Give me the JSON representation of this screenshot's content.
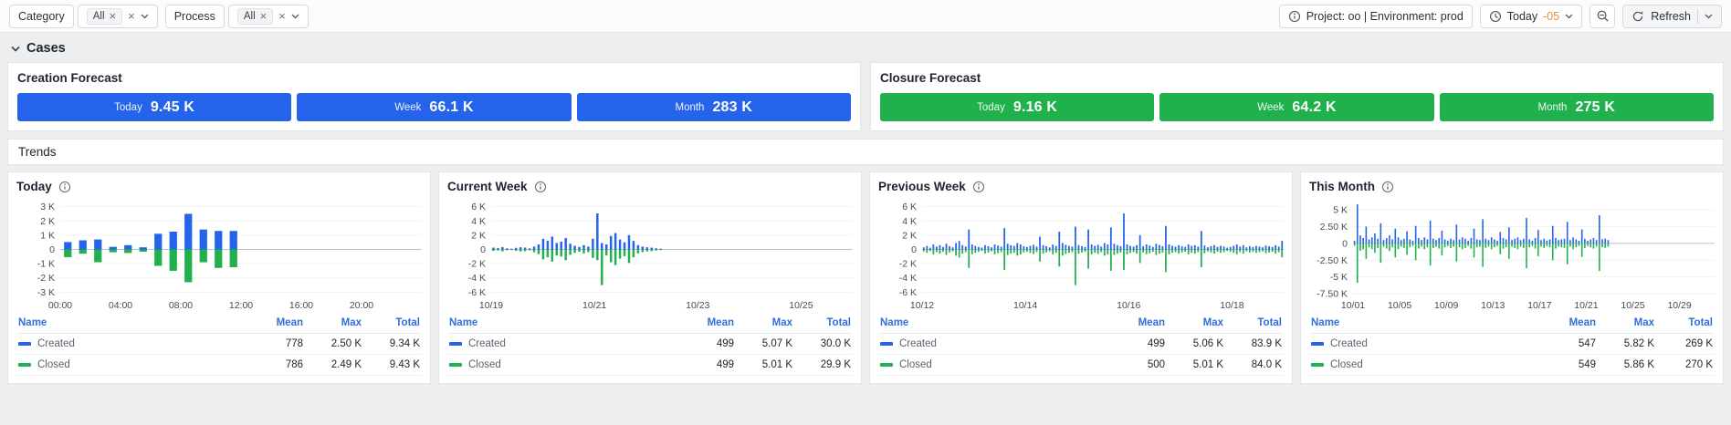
{
  "icons": {
    "close": "×"
  },
  "toolbar": {
    "filters": [
      {
        "label": "Category",
        "tag": "All"
      },
      {
        "label": "Process",
        "tag": "All"
      }
    ],
    "project_info": "Project: oo | Environment: prod",
    "time": {
      "label": "Today",
      "offset": "-05"
    },
    "refresh": "Refresh"
  },
  "section_title": "Cases",
  "forecasts": [
    {
      "title": "Creation Forecast",
      "color": "#2563eb",
      "stats": [
        {
          "label": "Today",
          "value": "9.45 K"
        },
        {
          "label": "Week",
          "value": "66.1 K"
        },
        {
          "label": "Month",
          "value": "283 K"
        }
      ]
    },
    {
      "title": "Closure Forecast",
      "color": "#21b14c",
      "stats": [
        {
          "label": "Today",
          "value": "9.16 K"
        },
        {
          "label": "Week",
          "value": "64.2 K"
        },
        {
          "label": "Month",
          "value": "275 K"
        }
      ]
    }
  ],
  "trends_title": "Trends",
  "cards": [
    {
      "title": "Today",
      "table": {
        "headers": [
          "Name",
          "Mean",
          "Max",
          "Total"
        ],
        "rows": [
          {
            "name": "Created",
            "color": "#2563eb",
            "mean": "778",
            "max": "2.50 K",
            "total": "9.34 K"
          },
          {
            "name": "Closed",
            "color": "#21b14c",
            "mean": "786",
            "max": "2.49 K",
            "total": "9.43 K"
          }
        ]
      }
    },
    {
      "title": "Current Week",
      "table": {
        "headers": [
          "Name",
          "Mean",
          "Max",
          "Total"
        ],
        "rows": [
          {
            "name": "Created",
            "color": "#2563eb",
            "mean": "499",
            "max": "5.07 K",
            "total": "30.0 K"
          },
          {
            "name": "Closed",
            "color": "#21b14c",
            "mean": "499",
            "max": "5.01 K",
            "total": "29.9 K"
          }
        ]
      }
    },
    {
      "title": "Previous Week",
      "table": {
        "headers": [
          "Name",
          "Mean",
          "Max",
          "Total"
        ],
        "rows": [
          {
            "name": "Created",
            "color": "#2563eb",
            "mean": "499",
            "max": "5.06 K",
            "total": "83.9 K"
          },
          {
            "name": "Closed",
            "color": "#21b14c",
            "mean": "500",
            "max": "5.01 K",
            "total": "84.0 K"
          }
        ]
      }
    },
    {
      "title": "This Month",
      "table": {
        "headers": [
          "Name",
          "Mean",
          "Max",
          "Total"
        ],
        "rows": [
          {
            "name": "Created",
            "color": "#2563eb",
            "mean": "547",
            "max": "5.82 K",
            "total": "269 K"
          },
          {
            "name": "Closed",
            "color": "#21b14c",
            "mean": "549",
            "max": "5.86 K",
            "total": "270 K"
          }
        ]
      }
    }
  ],
  "chart_data": [
    {
      "type": "bar",
      "title": "Today",
      "slots": 24,
      "ymin": -3300,
      "ymax": 3300,
      "y_ticks": [
        {
          "label": "3 K",
          "v": 3000
        },
        {
          "label": "2 K",
          "v": 2000
        },
        {
          "label": "1 K",
          "v": 1000
        },
        {
          "label": "0",
          "v": 0
        },
        {
          "label": "-1 K",
          "v": -1000
        },
        {
          "label": "-2 K",
          "v": -2000
        },
        {
          "label": "-3 K",
          "v": -3000
        }
      ],
      "x_ticks": [
        {
          "label": "00:00",
          "pos": 0
        },
        {
          "label": "04:00",
          "pos": 0.1667
        },
        {
          "label": "08:00",
          "pos": 0.3333
        },
        {
          "label": "12:00",
          "pos": 0.5
        },
        {
          "label": "16:00",
          "pos": 0.6667
        },
        {
          "label": "20:00",
          "pos": 0.8333
        }
      ],
      "series": [
        {
          "name": "Created",
          "color": "#2563eb",
          "values": [
            520,
            640,
            700,
            180,
            300,
            150,
            1100,
            1250,
            2500,
            1400,
            1300,
            1300
          ]
        },
        {
          "name": "Closed",
          "color": "#21b14c",
          "values": [
            540,
            300,
            900,
            200,
            250,
            160,
            1150,
            1500,
            2300,
            900,
            1300,
            1250
          ]
        }
      ]
    },
    {
      "type": "bar",
      "title": "Current Week",
      "slots": 80,
      "ymin": -6600,
      "ymax": 6600,
      "y_ticks": [
        {
          "label": "6 K",
          "v": 6000
        },
        {
          "label": "4 K",
          "v": 4000
        },
        {
          "label": "2 K",
          "v": 2000
        },
        {
          "label": "0",
          "v": 0
        },
        {
          "label": "-2 K",
          "v": -2000
        },
        {
          "label": "-4 K",
          "v": -4000
        },
        {
          "label": "-6 K",
          "v": -6000
        }
      ],
      "x_ticks": [
        {
          "label": "10/19",
          "pos": 0
        },
        {
          "label": "10/21",
          "pos": 0.2857
        },
        {
          "label": "10/23",
          "pos": 0.5714
        },
        {
          "label": "10/25",
          "pos": 0.8571
        }
      ],
      "series": [
        {
          "name": "Created",
          "color": "#2563eb",
          "values": [
            250,
            180,
            320,
            150,
            100,
            220,
            300,
            260,
            150,
            400,
            700,
            1500,
            1200,
            1800,
            900,
            1100,
            1600,
            800,
            500,
            350,
            600,
            400,
            1500,
            5070,
            900,
            700,
            1900,
            2300,
            1400,
            1000,
            2000,
            1200,
            600,
            400,
            300,
            250,
            150,
            100
          ]
        },
        {
          "name": "Closed",
          "color": "#21b14c",
          "values": [
            200,
            150,
            280,
            120,
            90,
            200,
            280,
            240,
            130,
            380,
            650,
            1400,
            1100,
            1700,
            850,
            1000,
            1500,
            750,
            480,
            320,
            550,
            380,
            1200,
            1500,
            5010,
            850,
            1800,
            2200,
            1300,
            950,
            1900,
            1100,
            550,
            380,
            280,
            230,
            140,
            90
          ]
        }
      ]
    },
    {
      "type": "bar",
      "title": "Previous Week",
      "slots": 112,
      "ymin": -6600,
      "ymax": 6600,
      "y_ticks": [
        {
          "label": "6 K",
          "v": 6000
        },
        {
          "label": "4 K",
          "v": 4000
        },
        {
          "label": "2 K",
          "v": 2000
        },
        {
          "label": "0",
          "v": 0
        },
        {
          "label": "-2 K",
          "v": -2000
        },
        {
          "label": "-4 K",
          "v": -4000
        },
        {
          "label": "-6 K",
          "v": -6000
        }
      ],
      "x_ticks": [
        {
          "label": "10/12",
          "pos": 0
        },
        {
          "label": "10/14",
          "pos": 0.2857
        },
        {
          "label": "10/16",
          "pos": 0.5714
        },
        {
          "label": "10/18",
          "pos": 0.8571
        }
      ],
      "series": [
        {
          "name": "Created",
          "color": "#2563eb",
          "values": [
            300,
            500,
            250,
            700,
            400,
            600,
            350,
            800,
            450,
            300,
            900,
            1200,
            600,
            400,
            2800,
            700,
            500,
            350,
            250,
            600,
            450,
            300,
            700,
            550,
            400,
            3000,
            800,
            600,
            500,
            900,
            700,
            450,
            350,
            500,
            650,
            400,
            1800,
            600,
            450,
            300,
            700,
            500,
            2500,
            900,
            650,
            500,
            400,
            3200,
            600,
            450,
            350,
            2800,
            700,
            500,
            650,
            400,
            900,
            700,
            3100,
            800,
            600,
            450,
            5060,
            700,
            500,
            400,
            600,
            2000,
            450,
            700,
            550,
            350,
            800,
            600,
            450,
            3300,
            700,
            500,
            400,
            600,
            450,
            350,
            700,
            500,
            600,
            400,
            2600,
            550,
            300,
            450,
            600,
            350,
            500,
            400,
            250,
            350,
            500,
            700,
            400,
            600,
            300,
            450,
            350,
            500,
            400,
            300,
            550,
            450,
            350,
            600,
            400,
            1200
          ]
        },
        {
          "name": "Closed",
          "color": "#21b14c",
          "values": [
            280,
            480,
            230,
            680,
            380,
            580,
            330,
            780,
            430,
            280,
            870,
            1150,
            580,
            380,
            2600,
            680,
            480,
            330,
            230,
            580,
            430,
            280,
            680,
            530,
            380,
            2900,
            780,
            580,
            480,
            870,
            680,
            430,
            330,
            480,
            630,
            380,
            1700,
            580,
            430,
            280,
            680,
            480,
            2400,
            870,
            630,
            480,
            380,
            5010,
            580,
            430,
            330,
            2700,
            680,
            480,
            630,
            380,
            870,
            680,
            3000,
            780,
            580,
            430,
            2900,
            680,
            480,
            380,
            580,
            1900,
            430,
            680,
            530,
            330,
            780,
            580,
            430,
            3200,
            680,
            480,
            380,
            580,
            430,
            330,
            680,
            480,
            580,
            380,
            2500,
            530,
            280,
            430,
            580,
            330,
            480,
            380,
            230,
            330,
            480,
            680,
            380,
            580,
            280,
            430,
            330,
            480,
            380,
            280,
            530,
            430,
            330,
            580,
            380,
            1100
          ]
        }
      ]
    },
    {
      "type": "bar",
      "title": "This Month",
      "slots": 124,
      "ymin": -7900,
      "ymax": 6100,
      "y_ticks": [
        {
          "label": "5 K",
          "v": 5000
        },
        {
          "label": "2.50 K",
          "v": 2500
        },
        {
          "label": "0",
          "v": 0
        },
        {
          "label": "-2.50 K",
          "v": -2500
        },
        {
          "label": "-5 K",
          "v": -5000
        },
        {
          "label": "-7.50 K",
          "v": -7500
        }
      ],
      "x_ticks": [
        {
          "label": "10/01",
          "pos": 0
        },
        {
          "label": "10/05",
          "pos": 0.129
        },
        {
          "label": "10/09",
          "pos": 0.258
        },
        {
          "label": "10/13",
          "pos": 0.387
        },
        {
          "label": "10/17",
          "pos": 0.516
        },
        {
          "label": "10/21",
          "pos": 0.645
        },
        {
          "label": "10/25",
          "pos": 0.774
        },
        {
          "label": "10/29",
          "pos": 0.903
        }
      ],
      "series": [
        {
          "name": "Created",
          "color": "#2563eb",
          "values": [
            400,
            5820,
            1200,
            800,
            2500,
            600,
            900,
            1500,
            700,
            3000,
            500,
            800,
            1200,
            600,
            2200,
            900,
            500,
            700,
            1800,
            600,
            400,
            2600,
            800,
            500,
            900,
            600,
            3400,
            700,
            500,
            800,
            1900,
            600,
            400,
            700,
            500,
            2800,
            600,
            900,
            700,
            400,
            800,
            2200,
            600,
            500,
            3600,
            700,
            500,
            900,
            600,
            400,
            1700,
            800,
            600,
            2400,
            500,
            700,
            900,
            500,
            700,
            3800,
            600,
            400,
            800,
            2000,
            500,
            700,
            400,
            600,
            2600,
            800,
            500,
            600,
            700,
            3200,
            500,
            900,
            600,
            400,
            2100,
            700,
            400,
            600,
            800,
            500,
            4200,
            600,
            700,
            500
          ]
        },
        {
          "name": "Closed",
          "color": "#21b14c",
          "values": [
            380,
            5860,
            1100,
            900,
            2300,
            580,
            870,
            1400,
            680,
            2900,
            480,
            780,
            1150,
            580,
            2100,
            870,
            480,
            680,
            1700,
            580,
            380,
            2500,
            780,
            480,
            870,
            580,
            3300,
            680,
            480,
            780,
            1800,
            580,
            380,
            680,
            480,
            2700,
            580,
            870,
            680,
            380,
            780,
            2100,
            580,
            480,
            3500,
            680,
            480,
            870,
            580,
            380,
            1600,
            780,
            580,
            2300,
            480,
            680,
            870,
            480,
            680,
            3700,
            580,
            380,
            780,
            1900,
            480,
            680,
            380,
            580,
            2500,
            780,
            480,
            580,
            680,
            3100,
            480,
            870,
            580,
            380,
            2000,
            680,
            380,
            580,
            780,
            480,
            4100,
            580,
            680,
            480
          ]
        }
      ]
    }
  ]
}
